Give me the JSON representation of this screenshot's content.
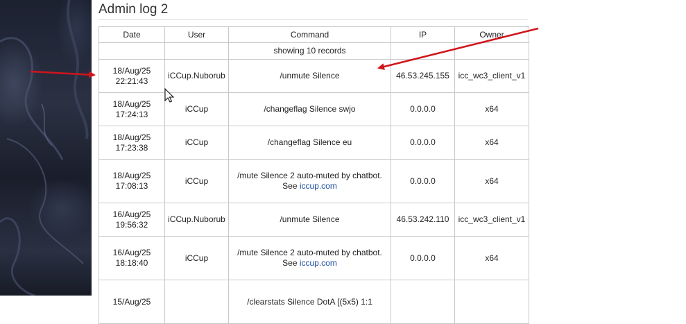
{
  "page": {
    "title": "Admin log 2"
  },
  "table": {
    "columns": [
      "Date",
      "User",
      "Command",
      "IP",
      "Owner"
    ],
    "info": "showing 10 records",
    "rows": [
      {
        "date1": "18/Aug/25",
        "date2": "22:21:43",
        "user": "iCCup.Nuborub",
        "cmd1": "/unmute Silence",
        "cmd2_prefix": "",
        "cmd2_link": "",
        "ip": "46.53.245.155",
        "owner": "icc_wc3_client_v1"
      },
      {
        "date1": "18/Aug/25",
        "date2": "17:24:13",
        "user": "iCCup",
        "cmd1": "/changeflag Silence swjo",
        "cmd2_prefix": "",
        "cmd2_link": "",
        "ip": "0.0.0.0",
        "owner": "x64"
      },
      {
        "date1": "18/Aug/25",
        "date2": "17:23:38",
        "user": "iCCup",
        "cmd1": "/changeflag Silence eu",
        "cmd2_prefix": "",
        "cmd2_link": "",
        "ip": "0.0.0.0",
        "owner": "x64"
      },
      {
        "date1": "18/Aug/25",
        "date2": "17:08:13",
        "user": "iCCup",
        "cmd1": "/mute Silence 2 auto-muted by chatbot.",
        "cmd2_prefix": "See ",
        "cmd2_link": "iccup.com",
        "ip": "0.0.0.0",
        "owner": "x64"
      },
      {
        "date1": "16/Aug/25",
        "date2": "19:56:32",
        "user": "iCCup.Nuborub",
        "cmd1": "/unmute Silence",
        "cmd2_prefix": "",
        "cmd2_link": "",
        "ip": "46.53.242.110",
        "owner": "icc_wc3_client_v1"
      },
      {
        "date1": "16/Aug/25",
        "date2": "18:18:40",
        "user": "iCCup",
        "cmd1": "/mute Silence 2 auto-muted by chatbot.",
        "cmd2_prefix": "See ",
        "cmd2_link": "iccup.com",
        "ip": "0.0.0.0",
        "owner": "x64"
      },
      {
        "date1": "15/Aug/25",
        "date2": "",
        "user": "",
        "cmd1": "/clearstats Silence DotA [(5x5) 1:1",
        "cmd2_prefix": "",
        "cmd2_link": "",
        "ip": "",
        "owner": ""
      }
    ]
  },
  "colors": {
    "annotation_arrow": "#d0141c",
    "link": "#1a4a9c",
    "border": "#c8c8c8"
  },
  "icons": {
    "cursor": "mouse-pointer-icon"
  }
}
